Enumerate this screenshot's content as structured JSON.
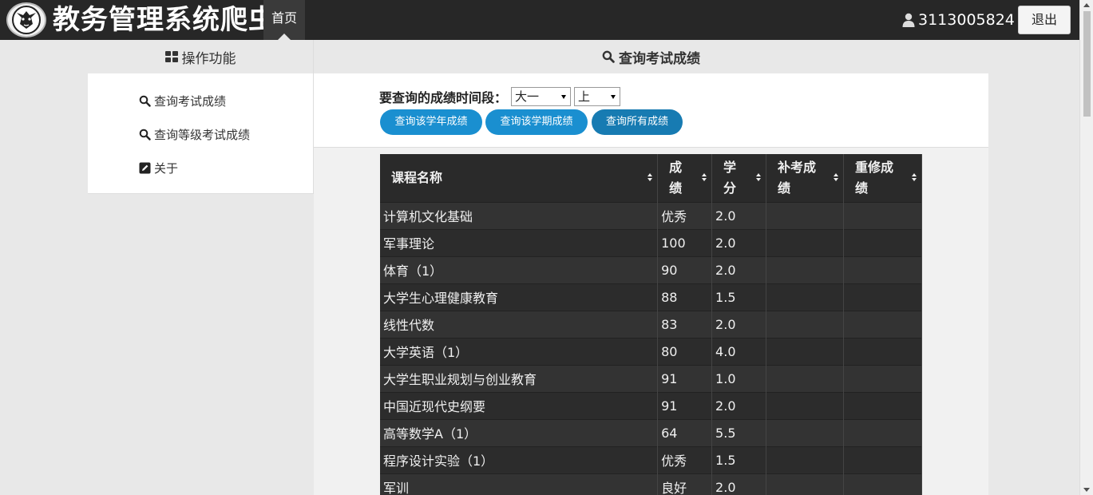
{
  "app": {
    "brand": "教务管理系统爬虫",
    "nav_home": "首页"
  },
  "user": {
    "id": "3113005824",
    "logout_label": "退出"
  },
  "sidebar": {
    "title": "操作功能",
    "items": [
      {
        "label": "查询考试成绩",
        "icon": "search-icon"
      },
      {
        "label": "查询等级考试成绩",
        "icon": "search-icon"
      },
      {
        "label": "关于",
        "icon": "edit-icon"
      }
    ]
  },
  "main": {
    "title": "查询考试成绩",
    "form": {
      "label": "要查询的成绩时间段：",
      "year_select": "大一",
      "term_select": "上",
      "btn_year": "查询该学年成绩",
      "btn_term": "查询该学期成绩",
      "btn_all": "查询所有成绩"
    }
  },
  "table": {
    "headers": [
      "课程名称",
      "成绩",
      "学分",
      "补考成绩",
      "重修成绩"
    ],
    "rows": [
      [
        "计算机文化基础",
        "优秀",
        "2.0",
        "",
        ""
      ],
      [
        "军事理论",
        "100",
        "2.0",
        "",
        ""
      ],
      [
        "体育（1）",
        "90",
        "2.0",
        "",
        ""
      ],
      [
        "大学生心理健康教育",
        "88",
        "1.5",
        "",
        ""
      ],
      [
        "线性代数",
        "83",
        "2.0",
        "",
        ""
      ],
      [
        "大学英语（1）",
        "80",
        "4.0",
        "",
        ""
      ],
      [
        "大学生职业规划与创业教育",
        "91",
        "1.0",
        "",
        ""
      ],
      [
        "中国近现代史纲要",
        "91",
        "2.0",
        "",
        ""
      ],
      [
        "高等数学A（1）",
        "64",
        "5.5",
        "",
        ""
      ],
      [
        "程序设计实验（1）",
        "优秀",
        "1.5",
        "",
        ""
      ],
      [
        "军训",
        "良好",
        "2.0",
        "",
        ""
      ]
    ]
  },
  "colors": {
    "topbar": "#272727",
    "button_blue": "#1a8fd0",
    "button_blue_active": "#177bb2",
    "table_bg": "#2f2f2f"
  }
}
